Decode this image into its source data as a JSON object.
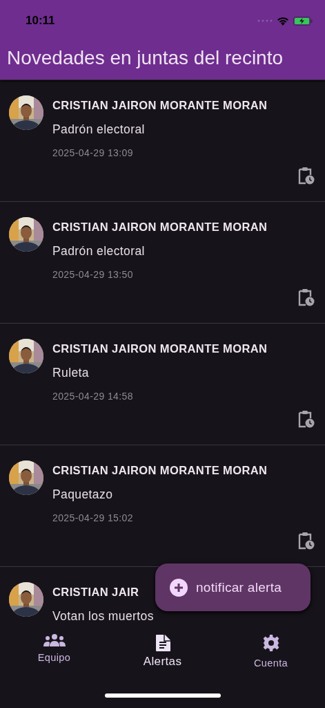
{
  "status_bar": {
    "time": "10:11"
  },
  "app_bar": {
    "title": "Novedades en juntas del recinto"
  },
  "alerts": [
    {
      "author": "CRISTIAN JAIRON MORANTE MORAN",
      "title": "Padrón electoral",
      "date": "2025-04-29 13:09"
    },
    {
      "author": "CRISTIAN JAIRON MORANTE MORAN",
      "title": "Padrón electoral",
      "date": "2025-04-29 13:50"
    },
    {
      "author": "CRISTIAN JAIRON MORANTE MORAN",
      "title": "Ruleta",
      "date": "2025-04-29 14:58"
    },
    {
      "author": "CRISTIAN JAIRON MORANTE MORAN",
      "title": "Paquetazo",
      "date": "2025-04-29 15:02"
    },
    {
      "author": "CRISTIAN JAIR",
      "title": "Votan los muertos"
    }
  ],
  "fab": {
    "label": "notificar alerta"
  },
  "bottom_nav": [
    {
      "label": "Equipo",
      "selected": false
    },
    {
      "label": "Alertas",
      "selected": true
    },
    {
      "label": "Cuenta",
      "selected": false
    }
  ]
}
